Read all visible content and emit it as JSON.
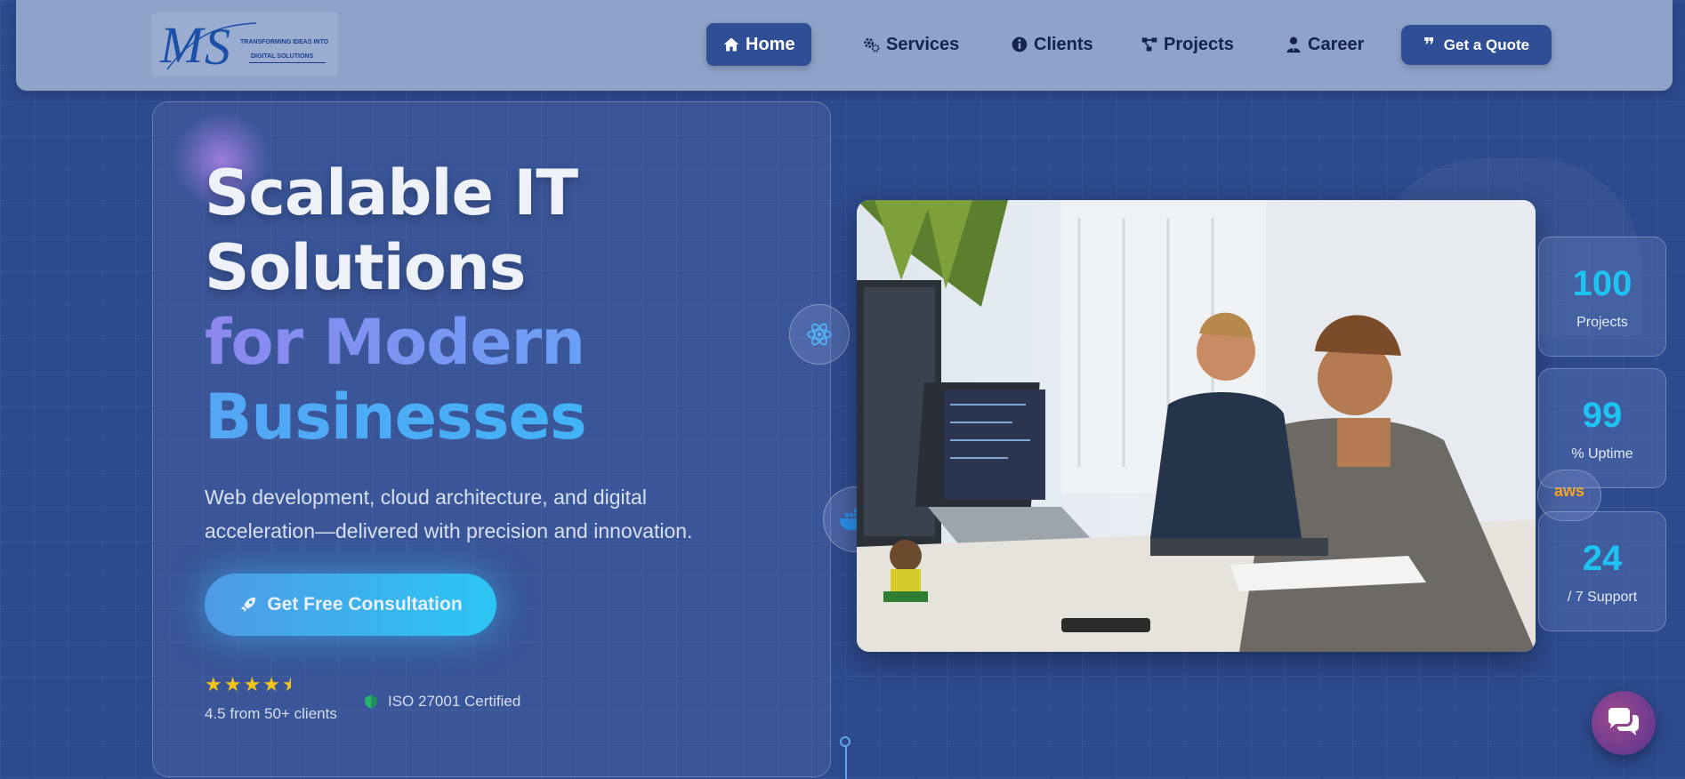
{
  "header": {
    "logo": {
      "letters": "MS",
      "tagline_line1": "TRANSFORMING IDEAS INTO",
      "tagline_line2": "DIGITAL SOLUTIONS"
    },
    "nav": [
      {
        "label": "Home",
        "icon": "home-icon",
        "active": true
      },
      {
        "label": "Services",
        "icon": "gears-icon",
        "active": false
      },
      {
        "label": "Clients",
        "icon": "info-icon",
        "active": false
      },
      {
        "label": "Projects",
        "icon": "diagram-icon",
        "active": false
      },
      {
        "label": "Career",
        "icon": "user-tie-icon",
        "active": false
      }
    ],
    "quote_button": "Get a Quote"
  },
  "hero": {
    "headline": {
      "line1": "Scalable IT",
      "line2": "Solutions",
      "line3": "for Modern",
      "line4": "Businesses"
    },
    "subtext_line1": "Web development, cloud architecture, and digital",
    "subtext_line2": "acceleration—delivered with precision and innovation.",
    "cta_label": "Get Free Consultation",
    "rating": {
      "stars": 4.5,
      "text": "4.5 from 50+ clients"
    },
    "certification": "ISO 27001 Certified"
  },
  "floating_icons": [
    "react-icon",
    "docker-icon",
    "aws-icon"
  ],
  "aws_label": "aws",
  "stats": [
    {
      "value": "100",
      "label": "Projects"
    },
    {
      "value": "99",
      "label": "% Uptime"
    },
    {
      "value": "24",
      "label": "/ 7 Support"
    }
  ],
  "colors": {
    "background": "#2d4a8e",
    "header": "#8fa3c9",
    "accent_cyan": "#1fc3f2",
    "star": "#f6c31c",
    "nav_active": "#2f4e96"
  }
}
